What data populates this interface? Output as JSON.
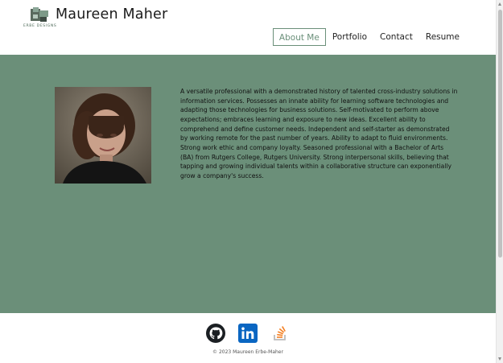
{
  "header": {
    "logo_icon": "erbe-designs-logo",
    "logo_caption": "ERBE DESIGNS",
    "site_title": "Maureen Maher"
  },
  "nav": {
    "items": [
      {
        "label": "About Me",
        "active": true
      },
      {
        "label": "Portfolio",
        "active": false
      },
      {
        "label": "Contact",
        "active": false
      },
      {
        "label": "Resume",
        "active": false
      }
    ]
  },
  "main": {
    "background_color": "#6b8f79",
    "photo_icon": "profile-photo",
    "bio": "A versatile professional with a demonstrated history of talented cross-industry solutions in information services. Possesses an innate ability for learning software technologies and adapting those technologies for business solutions. Self-motivated to perform above expectations; embraces learning and exposure to new ideas. Excellent ability to comprehend and define customer needs. Independent and self-starter as demonstrated by working remote for the past number of years. Ability to adapt to fluid environments. Strong work ethic and company loyalty. Seasoned professional with a Bachelor of Arts (BA) from Rutgers College, Rutgers University. Strong interpersonal skills, believing that tapping and growing individual talents within a collaborative structure can exponentially grow a company's success."
  },
  "footer": {
    "social": [
      {
        "icon": "github-icon",
        "color": "#1b1f23"
      },
      {
        "icon": "linkedin-icon",
        "color": "#0a66c2"
      },
      {
        "icon": "stackoverflow-icon",
        "color": "#f48024"
      }
    ],
    "copyright": "© 2023 Maureen Erbe-Maher"
  }
}
